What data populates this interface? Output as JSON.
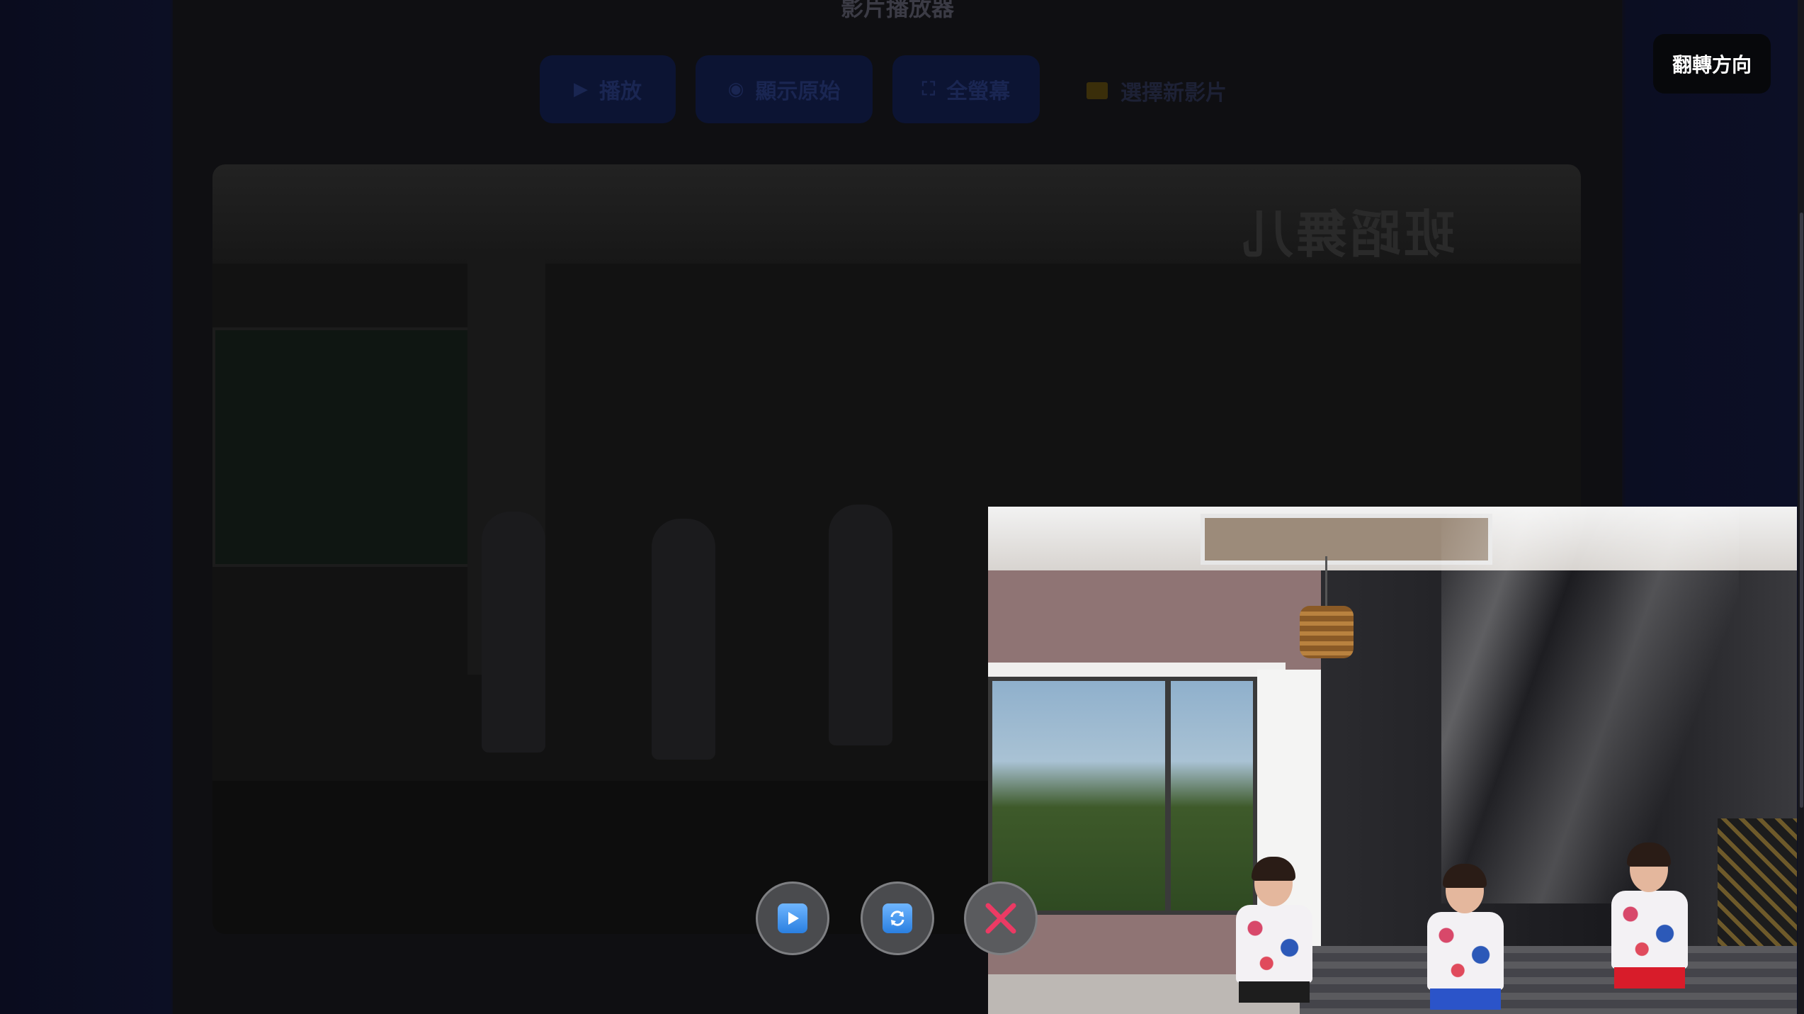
{
  "app": {
    "title": "影片播放器"
  },
  "toolbar": {
    "play_label": "播放",
    "show_original_label": "顯示原始",
    "fullscreen_label": "全螢幕",
    "select_video_label": "選擇新影片"
  },
  "overlay": {
    "flip_button_label": "翻轉方向"
  },
  "video": {
    "mirrored_sign_text": "班蹈舞儿"
  },
  "controls": {
    "play_icon": "play-icon",
    "refresh_icon": "refresh-icon",
    "close_icon": "close-icon"
  },
  "colors": {
    "accent_blue": "#2a7fe0",
    "close_red": "#e8345a"
  }
}
